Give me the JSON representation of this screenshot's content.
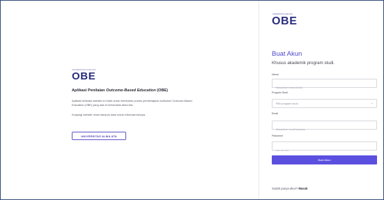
{
  "left": {
    "logo_kicker": "UNIVERSITAS ALMA ATA",
    "logo": "OBE",
    "app_title_prefix": "Aplikasi Penilaian ",
    "app_title_italic": "Outcome-Based Education",
    "app_title_suffix": " (OBE)",
    "description": "Aplikasi berbasis website ini hadir untuk membantu proses pembelajaran kurikulum Outcome-Based Education (OBE) yang ada di Universitas Alma Ata.",
    "hint": "Kunjungi website resmi kampus kami untuk informasi lainnya.",
    "university_button": "UNIVERSITAS ALMA ATA"
  },
  "right": {
    "logo_kicker": "UNIVERSITAS ALMA ATA",
    "logo": "OBE",
    "title": "Buat Akun",
    "subtitle": "Khusus akademik program studi.",
    "name_label": "Nama",
    "name_placeholder": "Masukkan nama Anda",
    "program_label": "Program Studi",
    "program_selected": "Pilih program studi",
    "email_label": "Email",
    "email_placeholder": "Masukkan email kampus",
    "password_label": "Password",
    "password_placeholder": "•••• •••• ••••",
    "submit_label": "Buat Akun",
    "login_prompt": "Sudah punya akun? ",
    "login_link": "Masuk"
  },
  "colors": {
    "brand": "#2a2d7d",
    "accent": "#5b4fe0",
    "frame": "#2f4a78"
  }
}
